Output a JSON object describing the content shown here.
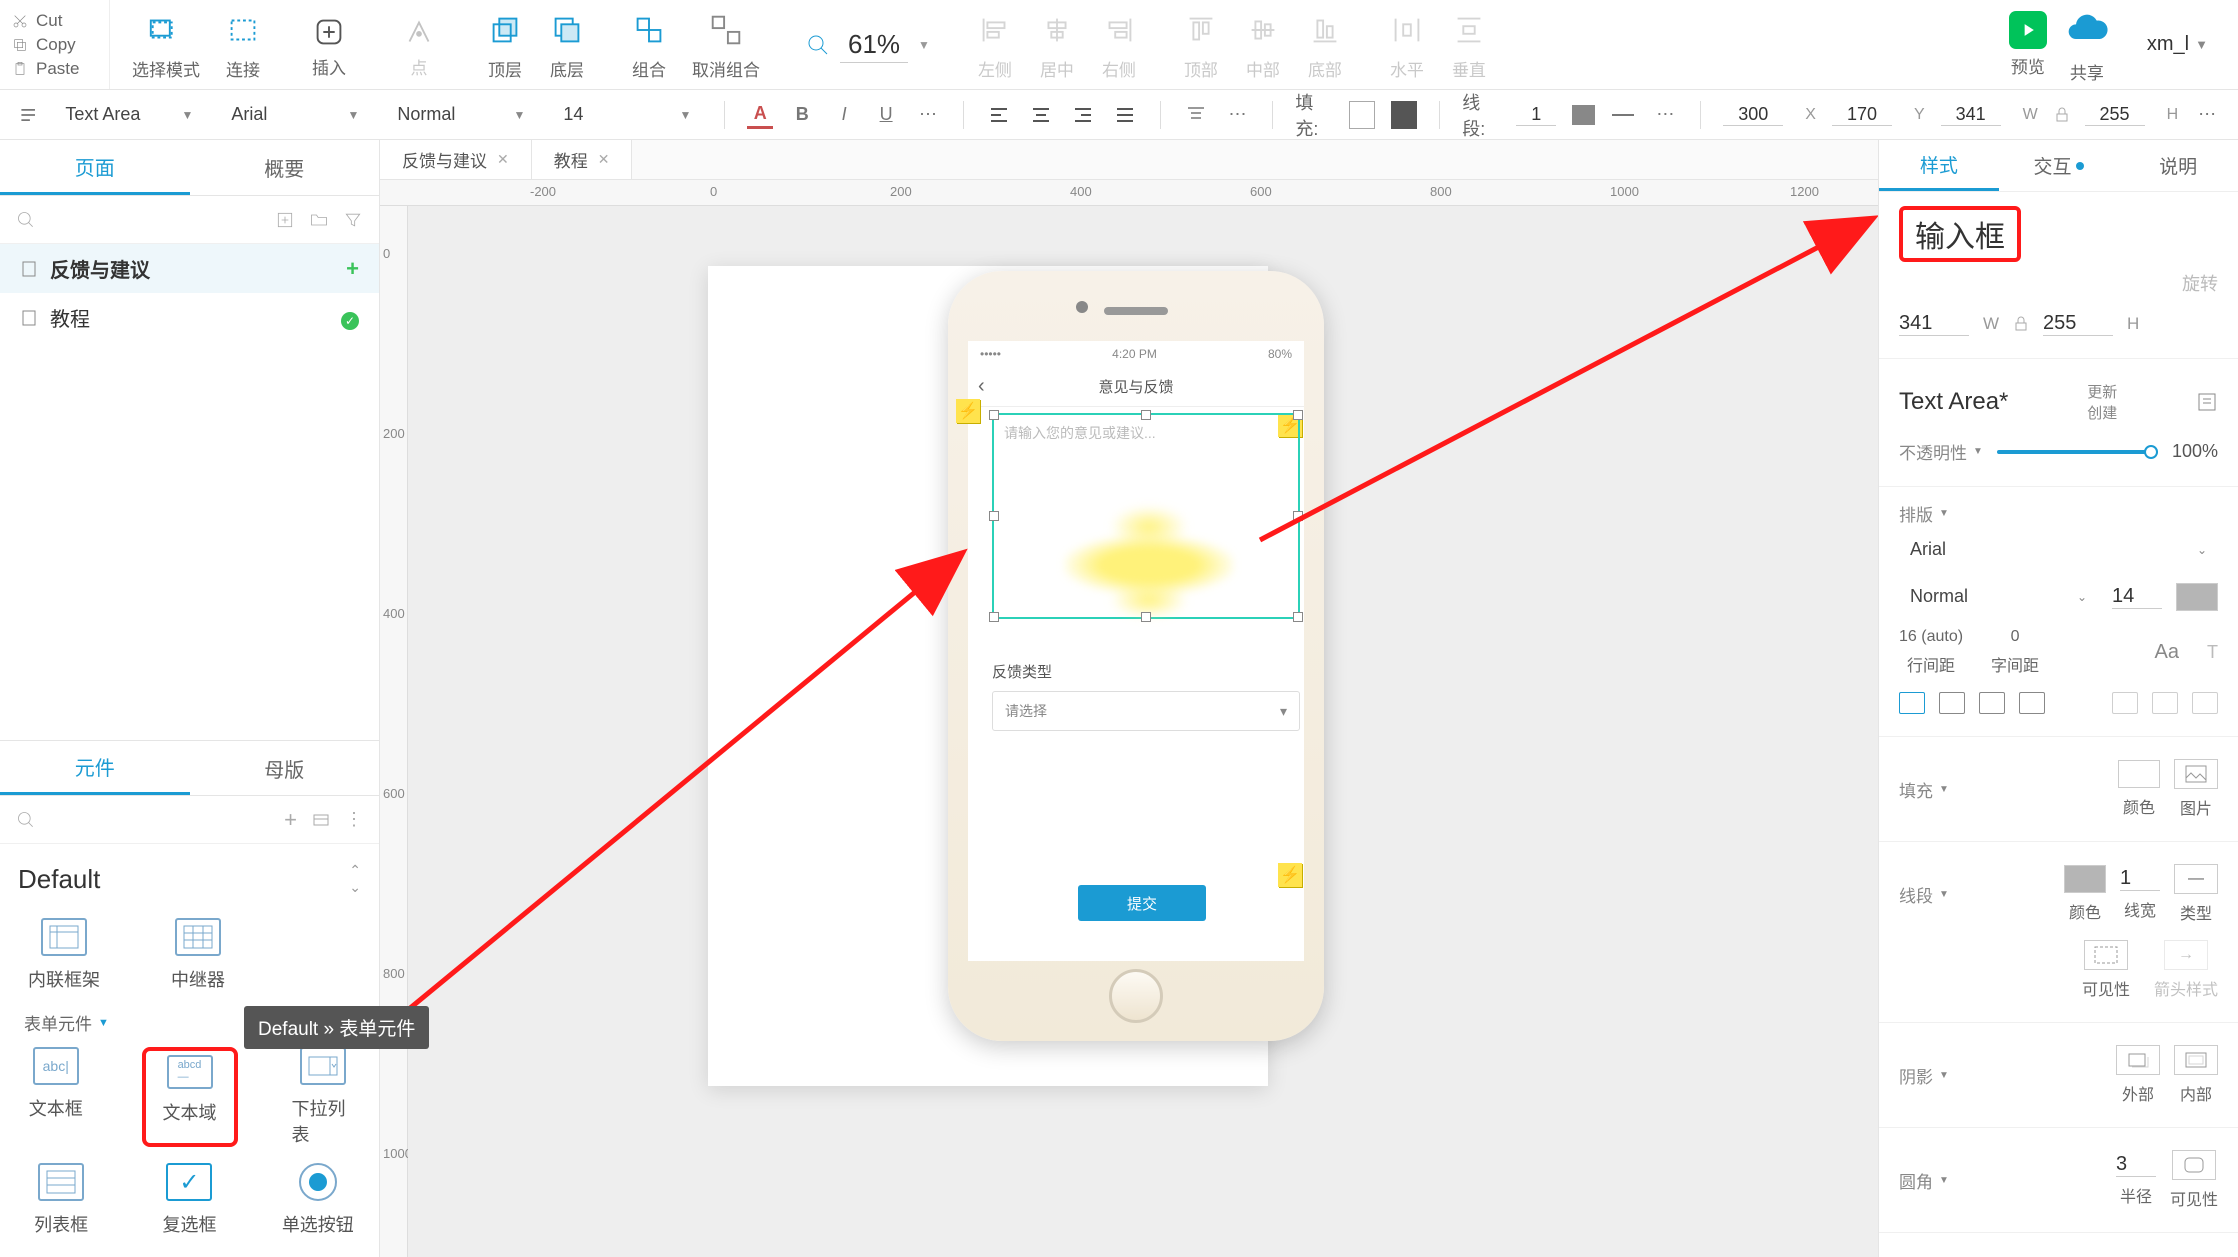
{
  "clip": {
    "cut": "Cut",
    "copy": "Copy",
    "paste": "Paste"
  },
  "toolbar": {
    "select_mode": "选择模式",
    "connect": "连接",
    "insert": "插入",
    "point": "点",
    "top_layer": "顶层",
    "bottom_layer": "底层",
    "group": "组合",
    "ungroup": "取消组合",
    "zoom": "61%",
    "align_left": "左侧",
    "align_center": "居中",
    "align_right": "右侧",
    "align_top": "顶部",
    "align_middle": "中部",
    "align_bottom": "底部",
    "dist_h": "水平",
    "dist_v": "垂直",
    "preview": "预览",
    "share": "共享",
    "user": "xm_l"
  },
  "toolbar2": {
    "shape_type": "Text Area",
    "font": "Arial",
    "weight": "Normal",
    "size": "14",
    "fill_label": "填充:",
    "stroke_label": "线段:",
    "stroke_w": "1",
    "x": "300",
    "y": "170",
    "w": "341",
    "h": "255",
    "xl": "X",
    "yl": "Y",
    "wl": "W",
    "hl": "H"
  },
  "left": {
    "tab_pages": "页面",
    "tab_outline": "概要",
    "pages": [
      {
        "name": "反馈与建议",
        "active": true,
        "badge": "plus"
      },
      {
        "name": "教程",
        "active": false,
        "badge": "check"
      }
    ],
    "tab_widgets": "元件",
    "tab_masters": "母版",
    "lib_name": "Default",
    "section_form": "表单元件",
    "items_top": [
      {
        "label": "内联框架"
      },
      {
        "label": "中继器"
      }
    ],
    "items_form1": [
      {
        "label": "文本框"
      },
      {
        "label": "文本域"
      },
      {
        "label": "下拉列表"
      }
    ],
    "items_form2": [
      {
        "label": "列表框"
      },
      {
        "label": "复选框"
      },
      {
        "label": "单选按钮"
      }
    ],
    "tooltip": "Default » 表单元件"
  },
  "doc_tabs": [
    {
      "label": "反馈与建议",
      "active": true
    },
    {
      "label": "教程",
      "active": false
    }
  ],
  "ruler_h": [
    "-200",
    "0",
    "200",
    "400",
    "600",
    "800",
    "1000",
    "1200"
  ],
  "ruler_v": [
    "0",
    "200",
    "400",
    "600",
    "800",
    "1000"
  ],
  "phone": {
    "time": "4:20 PM",
    "battery": "80%",
    "title": "意见与反馈",
    "placeholder": "请输入您的意见或建议...",
    "fb_type_label": "反馈类型",
    "dropdown": "请选择",
    "submit": "提交"
  },
  "right": {
    "tab_style": "样式",
    "tab_interact": "交互",
    "tab_note": "说明",
    "name": "输入框",
    "rotate": "旋转",
    "w": "341",
    "h": "255",
    "widget_type": "Text Area*",
    "update": "更新",
    "create": "创建",
    "opacity_label": "不透明性",
    "opacity": "100%",
    "typo_label": "排版",
    "font": "Arial",
    "weight": "Normal",
    "size": "14",
    "line_h": "16 (auto)",
    "line_h_label": "行间距",
    "letter": "0",
    "letter_label": "字间距",
    "fill_label": "填充",
    "fill_color": "颜色",
    "fill_img": "图片",
    "stroke_label": "线段",
    "stroke_color": "颜色",
    "stroke_w": "1",
    "stroke_w_label": "线宽",
    "stroke_type": "类型",
    "vis_label": "可见性",
    "arrow_label": "箭头样式",
    "shadow_label": "阴影",
    "shadow_out": "外部",
    "shadow_in": "内部",
    "radius_label": "圆角",
    "radius": "3",
    "radius_unit": "半径",
    "radius_vis": "可见性"
  }
}
